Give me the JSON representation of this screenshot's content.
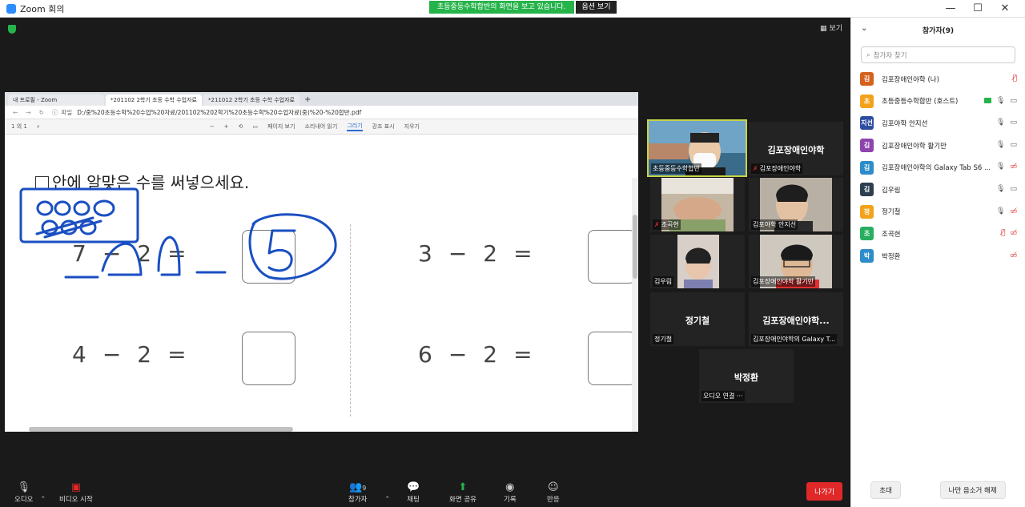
{
  "window": {
    "title": "Zoom 회의"
  },
  "share_banner": {
    "text": "초등중등수학합반의 화면을 보고 있습니다.",
    "options": "옵션 보기"
  },
  "window_controls": {
    "minimize": "—",
    "maximize": "☐",
    "close": "✕"
  },
  "view_button": "보기",
  "browser": {
    "tabs": [
      {
        "label": "내 프로필 - Zoom"
      },
      {
        "label": "*201102 2학기 초등 수학 수업자료"
      },
      {
        "label": "*211012 2학기 초등 수학 수업자료"
      }
    ],
    "address_prefix": "파일",
    "address": "D:/중%20초등수학%20수업%20자료/201102%202학기%20초등수학%20수업자료(중)%20-%20합반.pdf",
    "pdf_toolbar": {
      "page": "1",
      "page_of": "의 1",
      "page_view": "페이지 보기",
      "read_aloud": "소리내어 읽기",
      "draw": "그리기",
      "highlight": "강조 표시",
      "erase": "지우기"
    },
    "page": {
      "instruction": "안에 알맞은 수를 써넣으세요.",
      "problems": [
        {
          "a": "7",
          "op": "−",
          "b": "2",
          "eq": "="
        },
        {
          "a": "3",
          "op": "−",
          "b": "2",
          "eq": "="
        },
        {
          "a": "4",
          "op": "−",
          "b": "2",
          "eq": "="
        },
        {
          "a": "6",
          "op": "−",
          "b": "2",
          "eq": "="
        }
      ]
    }
  },
  "video_tiles": [
    {
      "name": "초등중등수학합반",
      "muted": false,
      "has_video": true
    },
    {
      "name": "김포장애인야학",
      "label": "김포장애인야학",
      "muted": true,
      "has_video": false
    },
    {
      "name": "조곡현",
      "muted": true,
      "has_video": true
    },
    {
      "name": "김포야학 안지선",
      "muted": false,
      "has_video": true
    },
    {
      "name": "김우림",
      "muted": false,
      "has_video": true
    },
    {
      "name": "김포장애인야학 활기만",
      "muted": false,
      "has_video": true
    },
    {
      "name": "정기철",
      "label": "정기철",
      "muted": false,
      "has_video": false
    },
    {
      "name": "김포장애인야학의 Galaxy T...",
      "label": "김포장애인야학...",
      "muted": false,
      "has_video": false
    },
    {
      "name": "오디오 연결 ···",
      "label": "박정환",
      "muted": false,
      "has_video": false
    }
  ],
  "toolbar": {
    "audio": "오디오",
    "video": "비디오 시작",
    "participants": "참가자",
    "participants_count": "9",
    "chat": "채팅",
    "share": "화면 공유",
    "record": "기록",
    "reactions": "반응",
    "leave": "나가기"
  },
  "panel": {
    "title": "참가자(9)",
    "search_placeholder": "참가자 찾기",
    "participants": [
      {
        "initial": "김",
        "color": "#d4621e",
        "name": "김포장애인야학 (나)",
        "mic": "off",
        "cam": "none",
        "host_tag": false
      },
      {
        "initial": "초",
        "color": "#f3a21c",
        "name": "초등중등수학합반 (호스트)",
        "mic": "on",
        "cam": "on",
        "host_tag": true
      },
      {
        "initial": "지선",
        "color": "#2d4da0",
        "name": "김포야학 안지선",
        "mic": "on",
        "cam": "on",
        "host_tag": false
      },
      {
        "initial": "김",
        "color": "#8e44ad",
        "name": "김포장애인야학 활기만",
        "mic": "on",
        "cam": "on",
        "host_tag": false
      },
      {
        "initial": "김",
        "color": "#2d8cc9",
        "name": "김포장애인야학의 Galaxy Tab S6 ...",
        "mic": "on",
        "cam": "off",
        "host_tag": false
      },
      {
        "initial": "김",
        "color": "#2c3e50",
        "name": "김우림",
        "mic": "on",
        "cam": "on",
        "host_tag": false
      },
      {
        "initial": "정",
        "color": "#f3a21c",
        "name": "정기철",
        "mic": "on",
        "cam": "off",
        "host_tag": false
      },
      {
        "initial": "조",
        "color": "#27ae60",
        "name": "조곡현",
        "mic": "off",
        "cam": "off",
        "host_tag": false
      },
      {
        "initial": "박",
        "color": "#2d8cc9",
        "name": "박정환",
        "mic": "none",
        "cam": "off",
        "host_tag": false
      }
    ],
    "footer": {
      "invite": "초대",
      "mute_all": "나만 음소거 해제"
    }
  }
}
